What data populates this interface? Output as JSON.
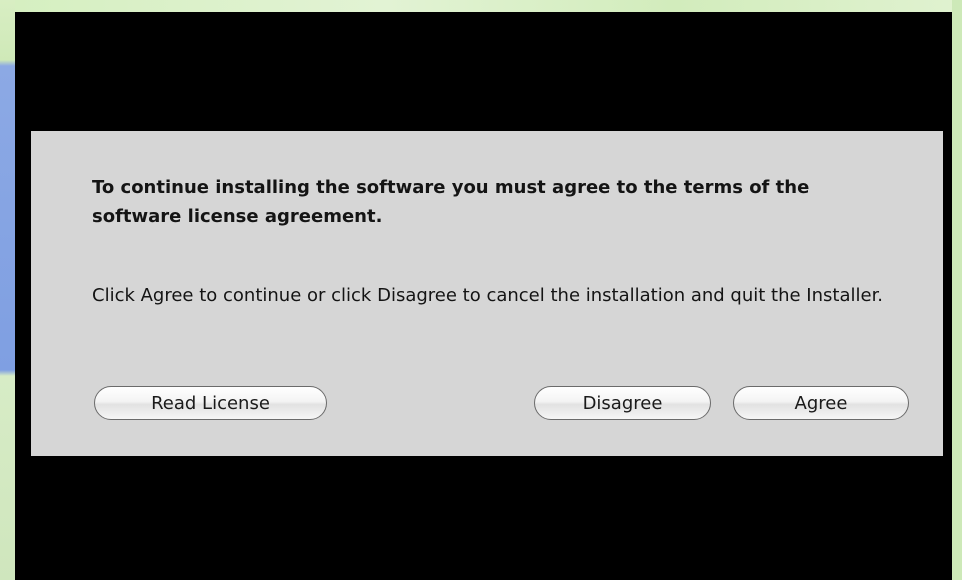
{
  "dialog": {
    "heading": "To continue installing the software you must agree to the terms of the software license agreement.",
    "message": "Click Agree to continue or click Disagree to cancel the installation and quit the Installer.",
    "buttons": {
      "read_license": "Read License",
      "disagree": "Disagree",
      "agree": "Agree"
    }
  },
  "colors": {
    "dialog_background": "#d6d6d6",
    "backdrop": "#000000",
    "outer_background": "#d9edc7"
  }
}
